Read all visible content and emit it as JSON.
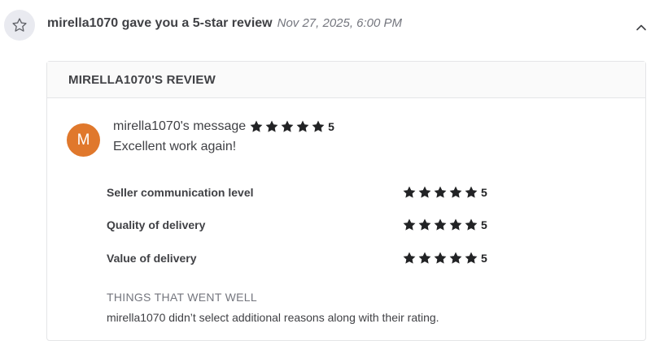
{
  "notification": {
    "icon": "star-outline-icon",
    "text": "mirella1070 gave you a 5-star review",
    "date": "Nov 27, 2025, 6:00 PM",
    "collapse_icon": "chevron-up-icon"
  },
  "review": {
    "header": "MIRELLA1070'S REVIEW",
    "avatar_initial": "M",
    "avatar_color": "#e0782c",
    "author_message_label": "mirella1070's message",
    "overall_rating": 5,
    "overall_rating_label": "5",
    "message": "Excellent work again!",
    "criteria": [
      {
        "label": "Seller communication level",
        "rating": 5,
        "rating_label": "5"
      },
      {
        "label": "Quality of delivery",
        "rating": 5,
        "rating_label": "5"
      },
      {
        "label": "Value of delivery",
        "rating": 5,
        "rating_label": "5"
      }
    ],
    "things_went_well_title": "THINGS THAT WENT WELL",
    "things_went_well_text": "mirella1070 didn’t select additional reasons along with their rating."
  },
  "colors": {
    "star": "#222325",
    "avatar": "#e0782c",
    "icon_circle_bg": "#e9eaf0"
  }
}
